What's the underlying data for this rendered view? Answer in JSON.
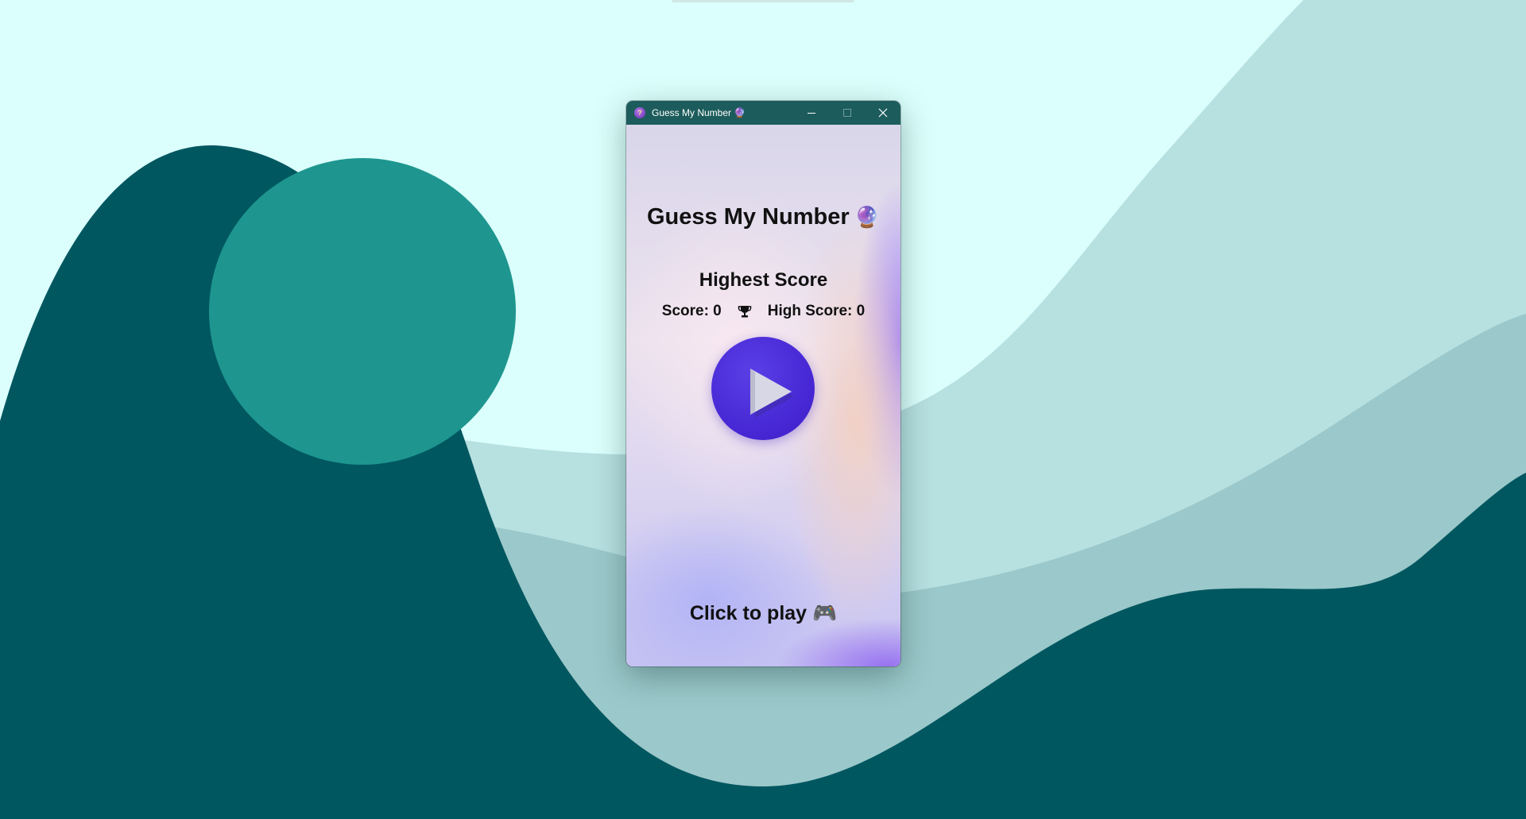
{
  "window": {
    "title": "Guess My Number 🔮",
    "controls": {
      "minimize_icon": "minimize-icon",
      "maximize_icon": "maximize-icon",
      "close_icon": "close-icon"
    }
  },
  "game": {
    "title": "Guess My Number",
    "title_emoji": "🔮",
    "highest_score_label": "Highest Score",
    "score_text": "Score: 0",
    "high_score_text": "High Score: 0",
    "trophy_icon": "trophy-icon",
    "play_icon": "play-icon",
    "cta_text": "Click to play",
    "cta_emoji": "🎮"
  },
  "colors": {
    "titlebar": "#1d5c5c",
    "play_button": "#4526d2",
    "wallpaper_light": "#dbfffc",
    "wallpaper_dark": "#005760",
    "wallpaper_circle": "#1e968f"
  }
}
